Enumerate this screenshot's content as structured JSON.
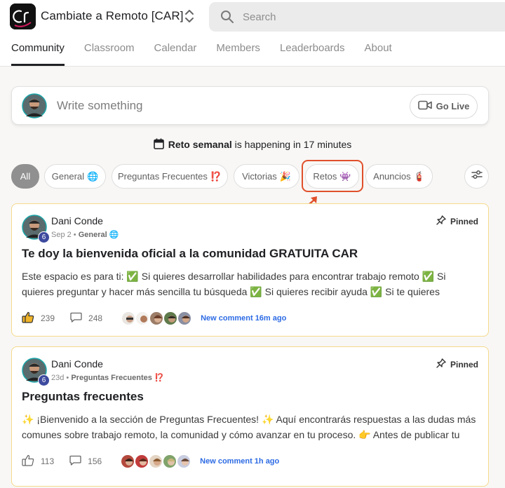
{
  "header": {
    "logo_icon": "community-logo-icon",
    "title": "Cambiate a Remoto [CAR]",
    "search_placeholder": "Search"
  },
  "tabs": [
    {
      "label": "Community",
      "active": true
    },
    {
      "label": "Classroom"
    },
    {
      "label": "Calendar"
    },
    {
      "label": "Members"
    },
    {
      "label": "Leaderboards"
    },
    {
      "label": "About"
    }
  ],
  "composer": {
    "placeholder": "Write something",
    "go_live_label": "Go Live"
  },
  "event": {
    "name": "Reto semanal",
    "suffix": " is happening in 17 minutes"
  },
  "filters": [
    {
      "label": "All",
      "emoji": "",
      "active": true
    },
    {
      "label": "General",
      "emoji": "🌐"
    },
    {
      "label": "Preguntas Frecuentes",
      "emoji": "⁉️"
    },
    {
      "label": "Victorias",
      "emoji": "🎉"
    },
    {
      "label": "Retos",
      "emoji": "👾",
      "highlighted": true
    },
    {
      "label": "Anuncios",
      "emoji": "🧯"
    }
  ],
  "posts": [
    {
      "author": "Dani Conde",
      "level": "6",
      "date": "Sep 2",
      "category": "General",
      "category_emoji": "🌐",
      "pinned_label": "Pinned",
      "title": "Te doy la bienvenida oficial a la comunidad GRATUITA CAR",
      "body": "Este espacio es para ti: ✅ Si quieres desarrollar habilidades para encontrar trabajo remoto ✅ Si quieres preguntar y hacer más sencilla tu búsqueda ✅ Si quieres recibir ayuda ✅ Si te quieres",
      "likes": "239",
      "comments": "248",
      "new_comment": "New comment 16m ago"
    },
    {
      "author": "Dani Conde",
      "level": "6",
      "date": "23d",
      "category": "Preguntas Frecuentes",
      "category_emoji": "⁉️",
      "pinned_label": "Pinned",
      "title": "Preguntas frecuentes",
      "body": "✨ ¡Bienvenido a la sección de Preguntas Frecuentes! ✨ Aquí encontrarás respuestas a las dudas más comunes sobre trabajo remoto, la comunidad y cómo avanzar en tu proceso. 👉 Antes de publicar tu",
      "likes": "113",
      "comments": "156",
      "new_comment": "New comment 1h ago"
    }
  ],
  "colors": {
    "accent_link": "#2d6be4",
    "highlight_red": "#e0502b",
    "post_border": "#f5d98c",
    "level_badge": "#3d4a9e"
  }
}
